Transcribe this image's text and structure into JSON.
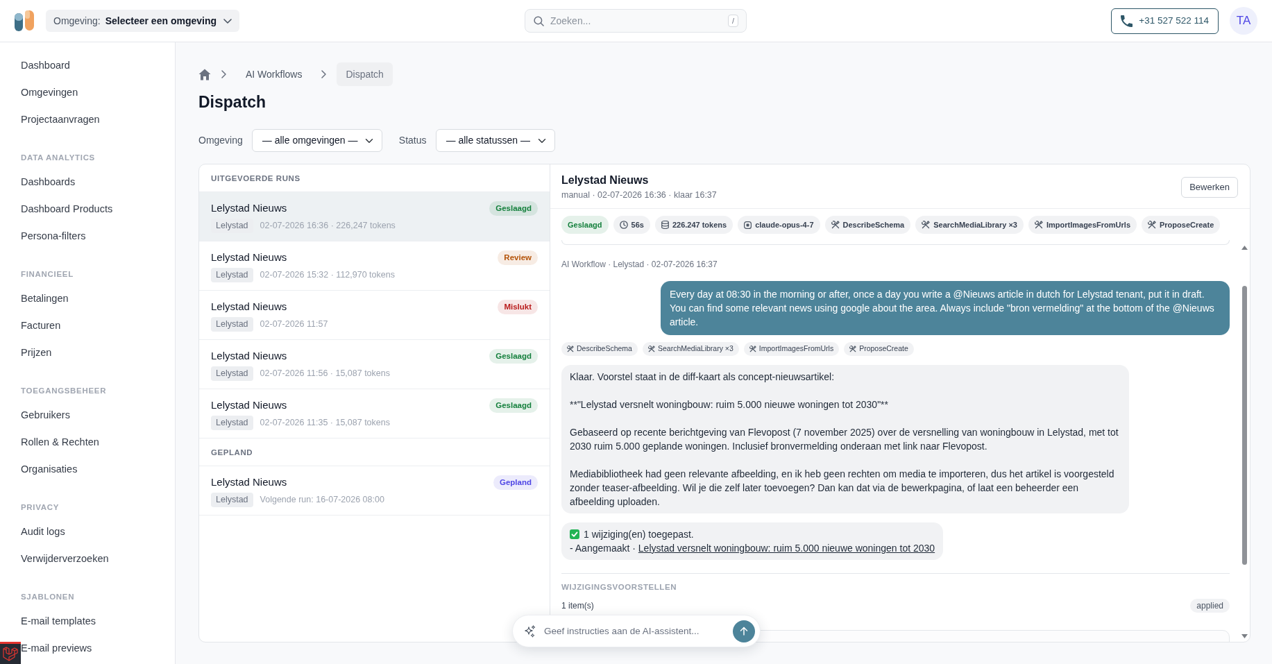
{
  "topbar": {
    "environment": {
      "label": "Omgeving:",
      "value": "Selecteer een omgeving"
    },
    "search": {
      "placeholder": "Zoeken...",
      "shortcut": "/"
    },
    "phone": "+31 527 522 114",
    "avatar": "TA"
  },
  "sidebar": [
    {
      "items": [
        "Dashboard",
        "Omgevingen",
        "Projectaanvragen"
      ]
    },
    {
      "title": "DATA ANALYTICS",
      "items": [
        "Dashboards",
        "Dashboard Products",
        "Persona-filters"
      ]
    },
    {
      "title": "FINANCIEEL",
      "items": [
        "Betalingen",
        "Facturen",
        "Prijzen"
      ]
    },
    {
      "title": "TOEGANGSBEHEER",
      "items": [
        "Gebruikers",
        "Rollen & Rechten",
        "Organisaties"
      ]
    },
    {
      "title": "PRIVACY",
      "items": [
        "Audit logs",
        "Verwijderverzoeken"
      ]
    },
    {
      "title": "SJABLONEN",
      "items": [
        "E-mail templates",
        "E-mail previews"
      ]
    }
  ],
  "breadcrumb": [
    {
      "label": "AI Workflows",
      "current": false
    },
    {
      "label": "Dispatch",
      "current": true
    }
  ],
  "page_title": "Dispatch",
  "filters": [
    {
      "label": "Omgeving",
      "value": "— alle omgevingen —"
    },
    {
      "label": "Status",
      "value": "— alle statussen —"
    }
  ],
  "runs": [
    {
      "title": "UITGEVOERDE RUNS",
      "items": [
        {
          "name": "Lelystad Nieuws",
          "status": "Geslaagd",
          "color": "#15803d",
          "tenant": "Lelystad",
          "meta": "02-07-2026 16:36 · 226,247 tokens",
          "selected": true
        },
        {
          "name": "Lelystad Nieuws",
          "status": "Review",
          "color": "#b45309",
          "tenant": "Lelystad",
          "meta": "02-07-2026 15:32 · 112,970 tokens",
          "selected": false
        },
        {
          "name": "Lelystad Nieuws",
          "status": "Mislukt",
          "color": "#b91c1c",
          "tenant": "Lelystad",
          "meta": "02-07-2026 11:57",
          "selected": false
        },
        {
          "name": "Lelystad Nieuws",
          "status": "Geslaagd",
          "color": "#15803d",
          "tenant": "Lelystad",
          "meta": "02-07-2026 11:56 · 15,087 tokens",
          "selected": false
        },
        {
          "name": "Lelystad Nieuws",
          "status": "Geslaagd",
          "color": "#15803d",
          "tenant": "Lelystad",
          "meta": "02-07-2026 11:35 · 15,087 tokens",
          "selected": false
        }
      ]
    },
    {
      "title": "GEPLAND",
      "items": [
        {
          "name": "Lelystad Nieuws",
          "status": "Gepland",
          "color": "#4f46e5",
          "tenant": "Lelystad",
          "meta": "Volgende run: 16-07-2026 08:00",
          "selected": false
        }
      ]
    }
  ],
  "detail": {
    "title": "Lelystad Nieuws",
    "subtitle": "manual · 02-07-2026 16:36 · klaar 16:37",
    "edit_button": "Bewerken",
    "chips": [
      {
        "kind": "status",
        "label": "Geslaagd",
        "color": "#15803d"
      },
      {
        "kind": "duration",
        "label": "56s"
      },
      {
        "kind": "tokens",
        "label": "226.247 tokens"
      },
      {
        "kind": "model",
        "label": "claude-opus-4-7"
      },
      {
        "kind": "tool",
        "label": "DescribeSchema"
      },
      {
        "kind": "tool",
        "label": "SearchMediaLibrary ×3"
      },
      {
        "kind": "tool",
        "label": "ImportImagesFromUrls"
      },
      {
        "kind": "tool",
        "label": "ProposeCreate"
      }
    ],
    "chat": {
      "meta": "AI Workflow · Lelystad · 02-07-2026 16:37",
      "messages": [
        {
          "kind": "user",
          "text": "Every day at 08:30 in the morning or after, once a day you write a @Nieuws article in dutch for Lelystad tenant, put it in draft. You can find some relevant news using google about the area. Always include \"bron vermelding\" at the bottom of the @Nieuws article."
        },
        {
          "kind": "tools",
          "tools": [
            "DescribeSchema",
            "SearchMediaLibrary ×3",
            "ImportImagesFromUrls",
            "ProposeCreate"
          ]
        },
        {
          "kind": "assistant",
          "paragraphs": [
            "Klaar. Voorstel staat in de diff-kaart als concept-nieuwsartikel:",
            "**\"Lelystad versnelt woningbouw: ruim 5.000 nieuwe woningen tot 2030\"**",
            "Gebaseerd op recente berichtgeving van Flevopost (7 november 2025) over de versnelling van woningbouw in Lelystad, met tot 2030 ruim 5.000 geplande woningen. Inclusief bronvermelding onderaan met link naar Flevopost.",
            "Mediabibliotheek had geen relevante afbeelding, en ik heb geen rechten om media te importeren, dus het artikel is voorgesteld zonder teaser-afbeelding. Wil je die zelf later toevoegen? Dan kan dat via de bewerkpagina, of laat een beheerder een afbeelding uploaden."
          ]
        },
        {
          "kind": "result",
          "summary": "1 wijziging(en) toegepast.",
          "action": "- Aangemaakt ·",
          "link": "Lelystad versnelt woningbouw: ruim 5.000 nieuwe woningen tot 2030"
        }
      ]
    },
    "proposals": {
      "title": "WIJZIGINGSVOORSTELLEN",
      "count": "1 item(s)",
      "status": "applied"
    }
  },
  "assistant_input": {
    "placeholder": "Geef instructies aan de AI-assistent..."
  }
}
